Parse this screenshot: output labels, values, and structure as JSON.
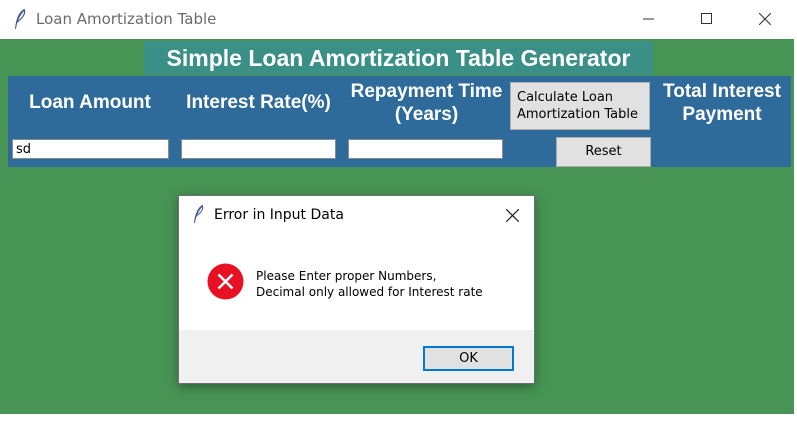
{
  "window": {
    "title": "Loan Amortization Table",
    "controls": [
      "minimize",
      "maximize",
      "close"
    ]
  },
  "app": {
    "heading": "Simple Loan Amortization Table Generator",
    "labels": {
      "loan_amount": "Loan Amount",
      "interest_rate": "Interest Rate(%)",
      "repayment_line1": "Repayment Time",
      "repayment_line2": "(Years)",
      "total_interest_line1": "Total Interest",
      "total_interest_line2": "Payment"
    },
    "inputs": {
      "loan_amount_value": "sd",
      "interest_rate_value": "",
      "repayment_value": ""
    },
    "buttons": {
      "calculate_line1": "Calculate Loan",
      "calculate_line2": "Amortization Table",
      "reset": "Reset"
    }
  },
  "dialog": {
    "title": "Error in Input Data",
    "icon": "error-icon",
    "message_line1": "Please Enter proper Numbers,",
    "message_line2": "Decimal only allowed for Interest rate",
    "ok": "OK"
  },
  "colors": {
    "background": "#479454",
    "panel": "#2e6a9a",
    "heading_bg": "#3a8f86",
    "error_red": "#e81123",
    "focus_blue": "#0078d7"
  }
}
